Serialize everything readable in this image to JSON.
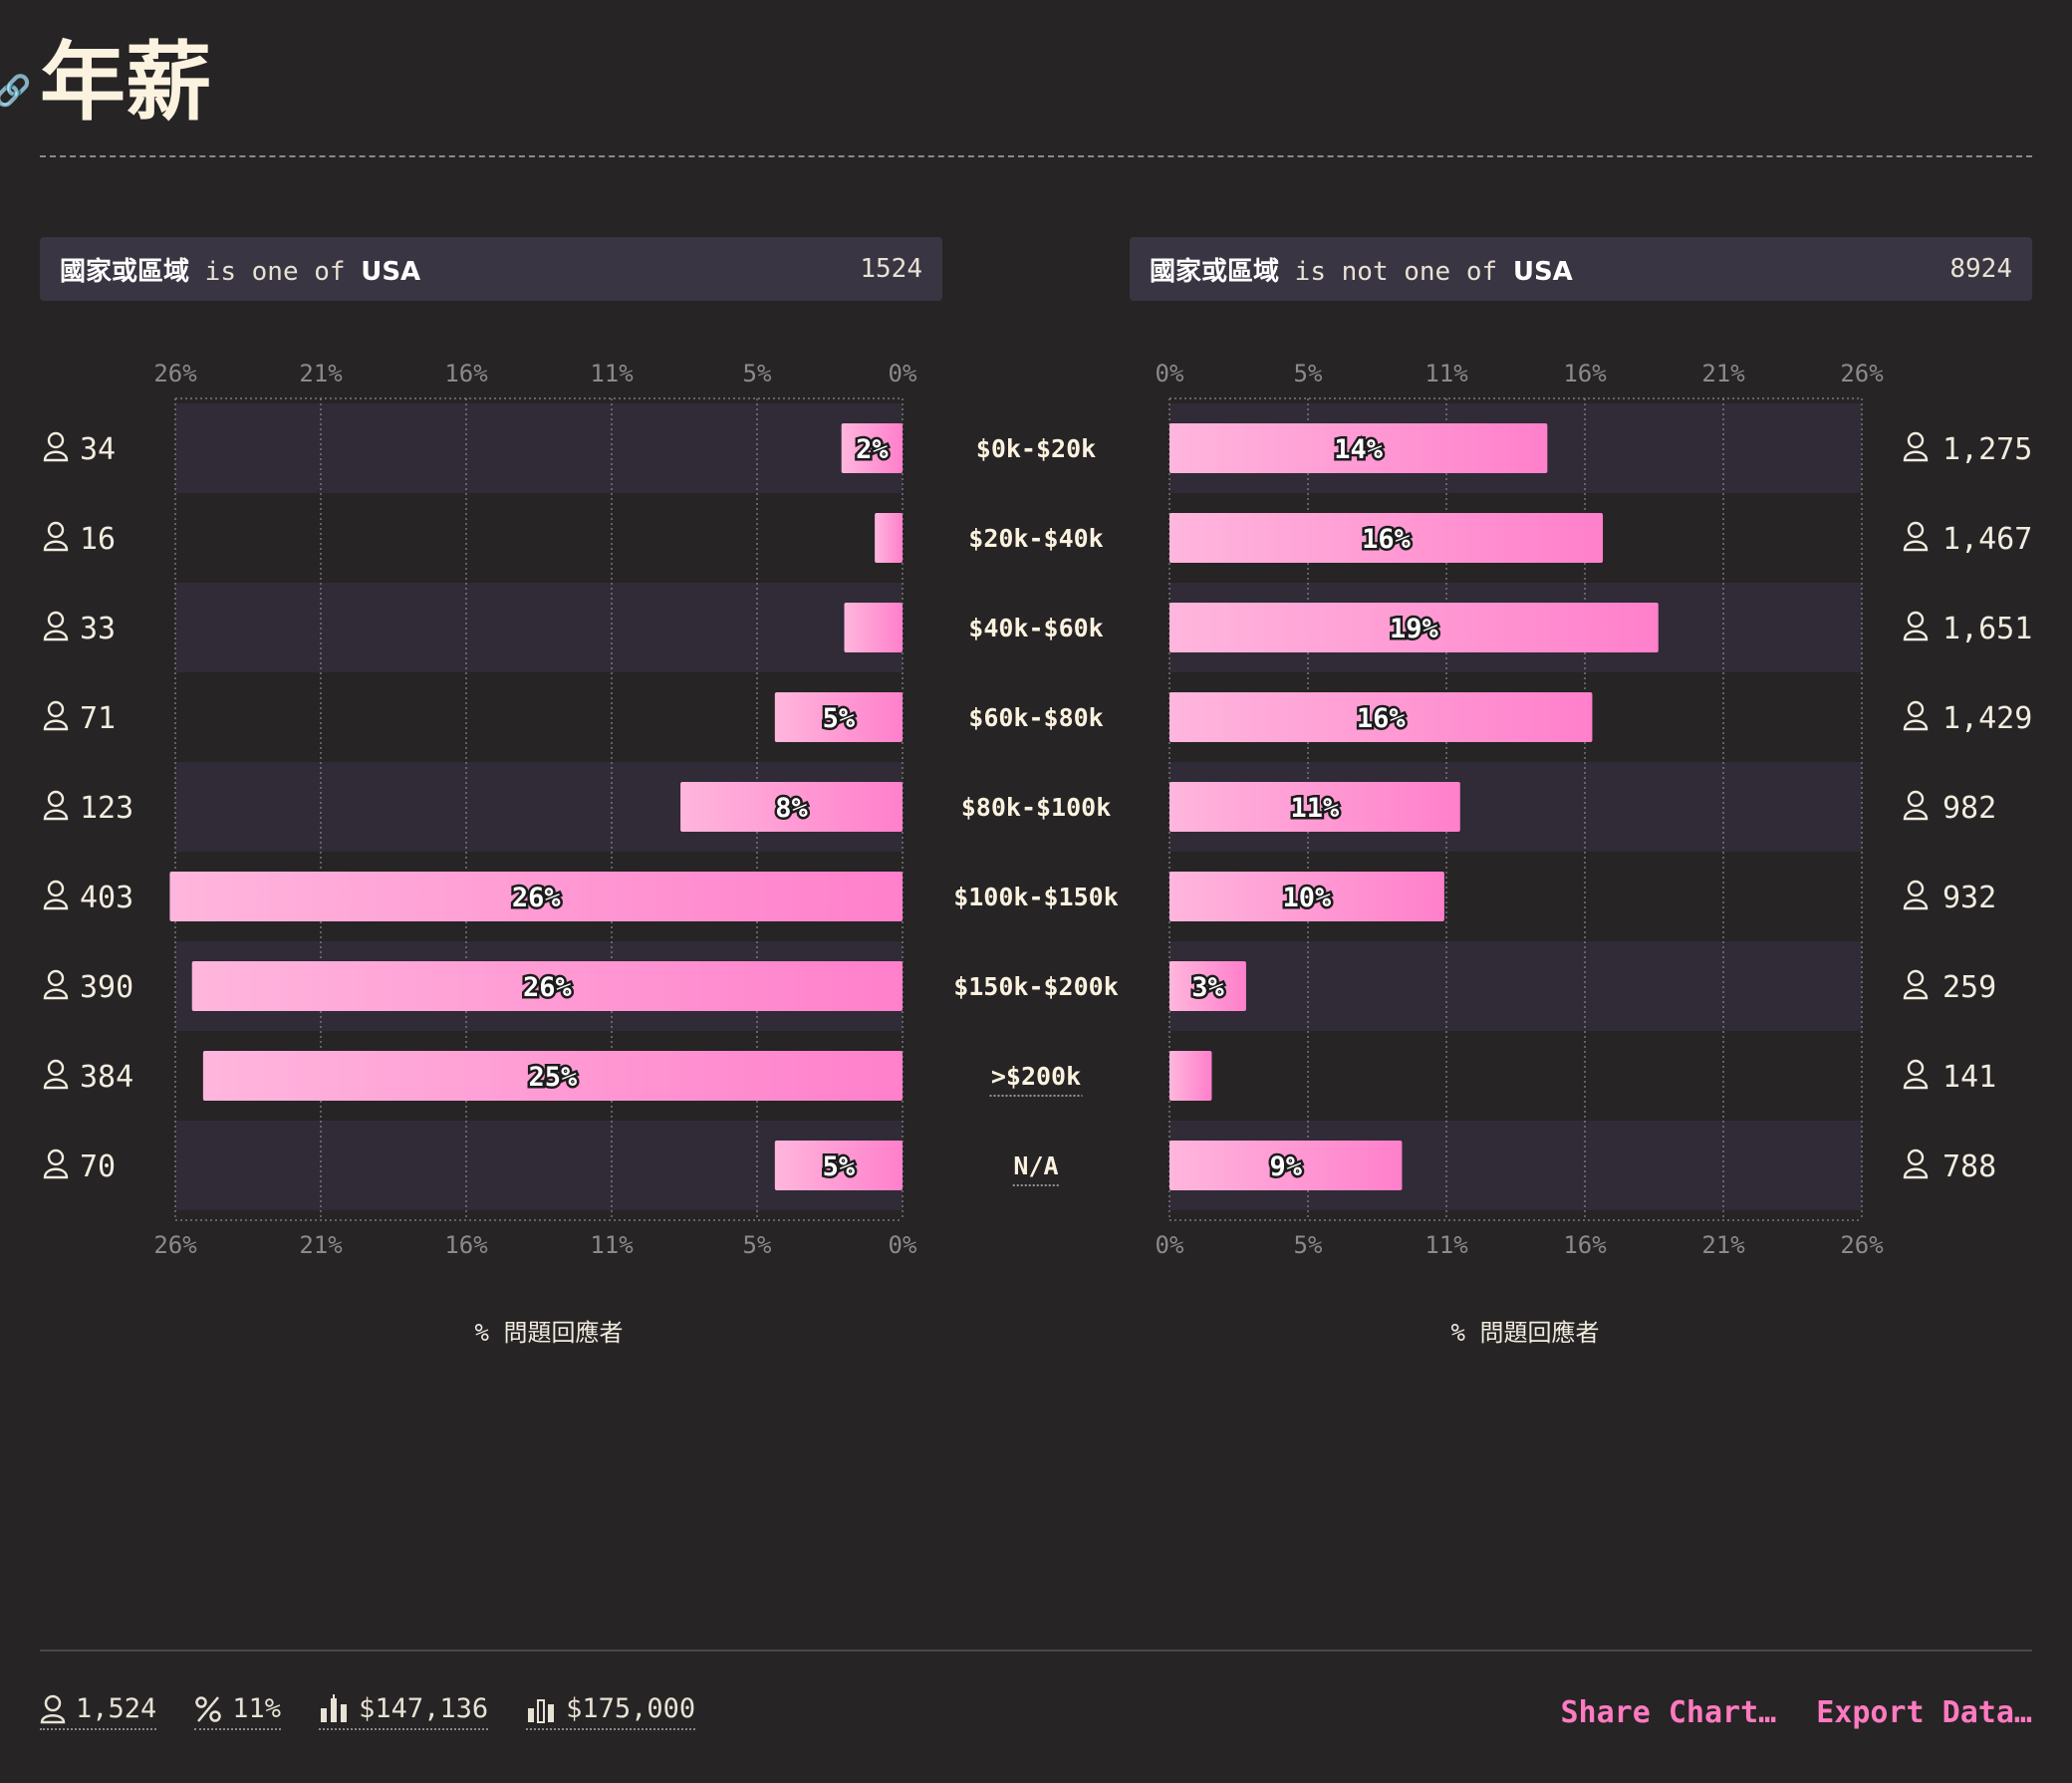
{
  "page": {
    "title": "年薪"
  },
  "filters": {
    "left": {
      "field": "國家或區域",
      "op": "is one of",
      "value": "USA",
      "count": "1524"
    },
    "right": {
      "field": "國家或區域",
      "op": "is not one of",
      "value": "USA",
      "count": "8924"
    }
  },
  "axis_title": "% 問題回應者",
  "colors": {
    "bar_start": "#ffb6dd",
    "bar_end": "#ff7fcb",
    "row_alt": "#302b36",
    "grid": "#8d8889",
    "accent": "#ff7ac0"
  },
  "chart_data": [
    {
      "type": "bar",
      "orientation": "horizontal",
      "direction": "right-to-left",
      "categories": [
        "$0k-$20k",
        "$20k-$40k",
        "$40k-$60k",
        "$60k-$80k",
        "$80k-$100k",
        "$100k-$150k",
        "$150k-$200k",
        ">$200k",
        "N/A"
      ],
      "values": [
        2.2,
        1.0,
        2.1,
        4.6,
        8.0,
        26.4,
        25.6,
        25.2,
        4.6
      ],
      "data_labels": [
        "2%",
        "",
        "",
        "5%",
        "8%",
        "26%",
        "26%",
        "25%",
        "5%"
      ],
      "counts": [
        "34",
        "16",
        "33",
        "71",
        "123",
        "403",
        "390",
        "384",
        "70"
      ],
      "xticks": [
        "26%",
        "21%",
        "16%",
        "11%",
        "5%",
        "0%"
      ],
      "xlim": [
        0,
        26.2
      ],
      "xlabel": "% 問題回應者"
    },
    {
      "type": "bar",
      "orientation": "horizontal",
      "direction": "left-to-right",
      "categories": [
        "$0k-$20k",
        "$20k-$40k",
        "$40k-$60k",
        "$60k-$80k",
        "$80k-$100k",
        "$100k-$150k",
        "$150k-$200k",
        ">$200k",
        "N/A"
      ],
      "values": [
        14.3,
        16.4,
        18.5,
        16.0,
        11.0,
        10.4,
        2.9,
        1.6,
        8.8
      ],
      "data_labels": [
        "14%",
        "16%",
        "19%",
        "16%",
        "11%",
        "10%",
        "3%",
        "",
        "9%"
      ],
      "counts": [
        "1,275",
        "1,467",
        "1,651",
        "1,429",
        "982",
        "932",
        "259",
        "141",
        "788"
      ],
      "xticks": [
        "0%",
        "5%",
        "11%",
        "16%",
        "21%",
        "26%"
      ],
      "xlim": [
        0,
        26.2
      ],
      "xlabel": "% 問題回應者"
    }
  ],
  "footer": {
    "respondents": "1,524",
    "percent": "11%",
    "mean": "$147,136",
    "median": "$175,000",
    "share_label": "Share Chart…",
    "export_label": "Export Data…"
  }
}
